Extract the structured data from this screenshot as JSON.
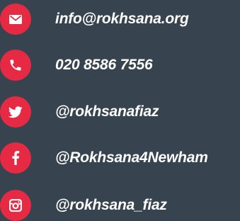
{
  "accent_color": "#e72a44",
  "background_color": "#37444f",
  "contacts": [
    {
      "icon": "envelope-icon",
      "label": "info@rokhsana.org"
    },
    {
      "icon": "phone-icon",
      "label": "020 8586 7556"
    },
    {
      "icon": "twitter-icon",
      "label": "@rokhsanafiaz"
    },
    {
      "icon": "facebook-icon",
      "label": "@Rokhsana4Newham"
    },
    {
      "icon": "instagram-icon",
      "label": "@rokhsana_fiaz"
    }
  ]
}
